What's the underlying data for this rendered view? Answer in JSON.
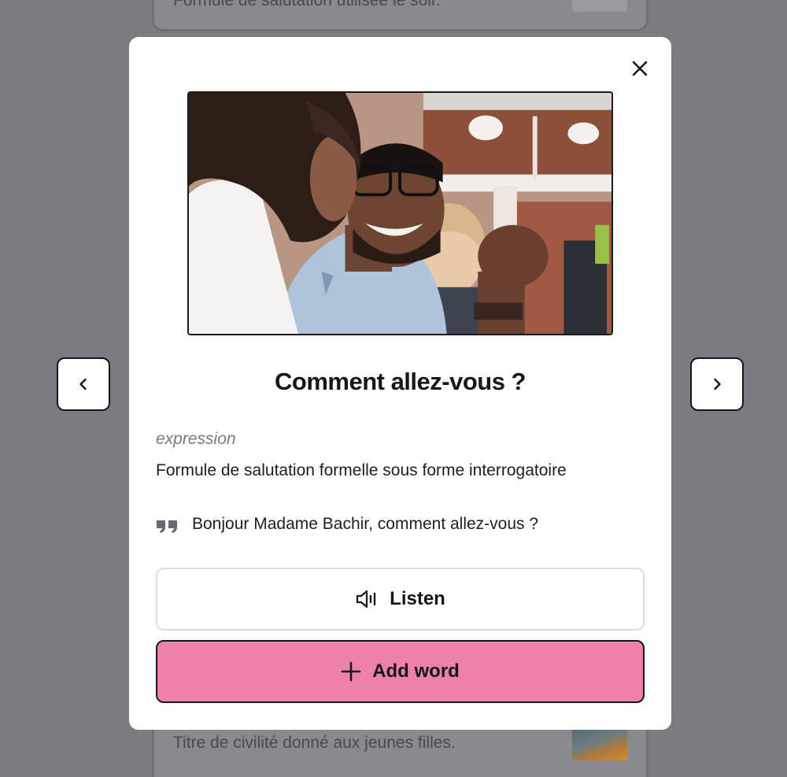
{
  "background": {
    "top_card_text": "Formule de salutation utilisée le soir.",
    "bottom_card_text": "Titre de civilité donné aux jeunes filles."
  },
  "modal": {
    "title": "Comment allez-vous ?",
    "word_type": "expression",
    "definition": "Formule de salutation formelle sous forme interrogatoire",
    "example": "Bonjour Madame Bachir, comment allez-vous ?",
    "listen_label": "Listen",
    "add_word_label": "Add word"
  },
  "icons": {
    "close": "close-icon",
    "prev": "chevron-left-icon",
    "next": "chevron-right-icon",
    "quote": "quote-icon",
    "speaker": "speaker-icon",
    "plus": "plus-icon"
  },
  "colors": {
    "overlay": "#7c7b7f",
    "accent_pink": "#ee81aa",
    "text_dark": "#17161b",
    "muted": "#7a7880"
  }
}
